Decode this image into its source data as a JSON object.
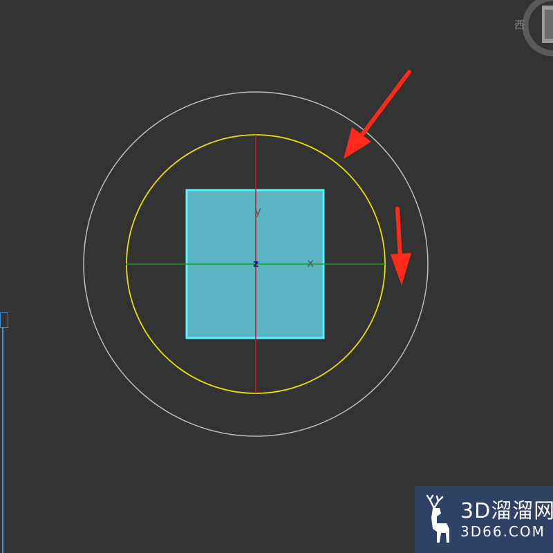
{
  "viewport": {
    "axis_labels": {
      "y": "y",
      "z": "z",
      "x": "x"
    },
    "viewcube_label": "西"
  },
  "colors": {
    "background": "#333333",
    "outer_ring": "#bdbdbd",
    "gizmo_ring": "#e8e000",
    "x_axis": "#12a012",
    "y_axis": "#cc1a1a",
    "plane_fill": "#5bb5c3",
    "plane_outline": "#52f4ff",
    "arrow": "#ff2a1a",
    "selection_accent": "#4b8fd0",
    "watermark_bg": "#2e4266"
  },
  "icons": {
    "viewcube": "viewcube-icon",
    "annotation_arrows": "red-arrow-icon",
    "watermark_logo": "deer-logo-icon"
  },
  "watermark": {
    "title": "3D溜溜网",
    "subtitle": "3D66.COM"
  }
}
